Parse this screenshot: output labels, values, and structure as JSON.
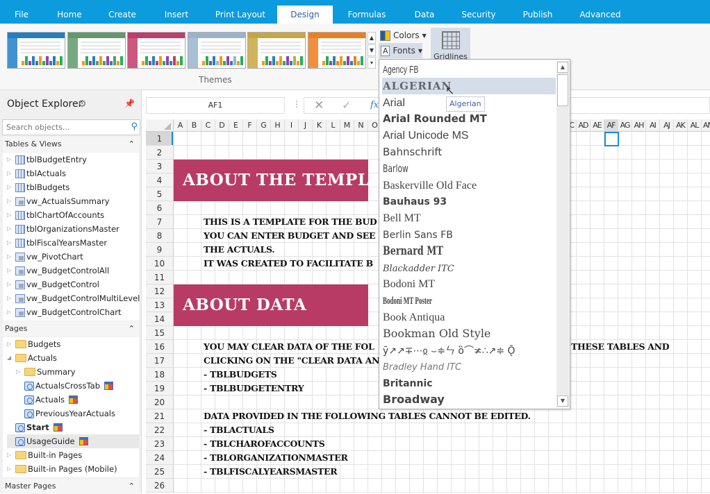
{
  "tabs": [
    {
      "label": "File"
    },
    {
      "label": "Home"
    },
    {
      "label": "Create"
    },
    {
      "label": "Insert"
    },
    {
      "label": "Print Layout"
    },
    {
      "label": "Design",
      "active": true
    },
    {
      "label": "Formulas"
    },
    {
      "label": "Data"
    },
    {
      "label": "Security"
    },
    {
      "label": "Publish"
    },
    {
      "label": "Advanced"
    }
  ],
  "ribbon": {
    "themes_label": "Themes",
    "themes": [
      {
        "color": "#1f7fc8"
      },
      {
        "color": "#5f9a6a"
      },
      {
        "color": "#c23b6b"
      },
      {
        "color": "#9ab4cf"
      },
      {
        "color": "#c8a640"
      },
      {
        "color": "#ef7d1a"
      }
    ],
    "colors_label": "Colors",
    "fonts_label": "Fonts",
    "gridlines_label": "Gridlines"
  },
  "explorer": {
    "title": "Object Explorer",
    "search_placeholder": "Search objects...",
    "tables_header": "Tables & Views",
    "tables": [
      {
        "label": "tblBudgetEntry",
        "type": "table"
      },
      {
        "label": "tblActuals",
        "type": "table"
      },
      {
        "label": "tblBudgets",
        "type": "table"
      },
      {
        "label": "vw_ActualsSummary",
        "type": "view"
      },
      {
        "label": "tblChartOfAccounts",
        "type": "table"
      },
      {
        "label": "tblOrganizationsMaster",
        "type": "table"
      },
      {
        "label": "tblFiscalYearsMaster",
        "type": "table"
      },
      {
        "label": "vw_PivotChart",
        "type": "view"
      },
      {
        "label": "vw_BudgetControlAll",
        "type": "view"
      },
      {
        "label": "vw_BudgetControl",
        "type": "view"
      },
      {
        "label": "vw_BudgetControlMultiLevel",
        "type": "view"
      },
      {
        "label": "vw_BudgetControlChart",
        "type": "view"
      }
    ],
    "pages_header": "Pages",
    "pages": [
      {
        "label": "Budgets",
        "type": "folder",
        "level": 0,
        "expand": "closed"
      },
      {
        "label": "Actuals",
        "type": "folder",
        "level": 0,
        "expand": "open"
      },
      {
        "label": "Summary",
        "type": "folder",
        "level": 1,
        "expand": "closed"
      },
      {
        "label": "ActualsCrossTab",
        "type": "page",
        "level": 1,
        "layout": true
      },
      {
        "label": "Actuals",
        "type": "page",
        "level": 1,
        "layout": true
      },
      {
        "label": "PreviousYearActuals",
        "type": "page",
        "level": 1
      },
      {
        "label": "Start",
        "type": "page",
        "level": 0,
        "layout": true,
        "bold": true
      },
      {
        "label": "UsageGuide",
        "type": "page",
        "level": 0,
        "layout": true,
        "selected": true
      },
      {
        "label": "Built-in Pages",
        "type": "folder",
        "level": 0,
        "expand": "closed"
      },
      {
        "label": "Built-in Pages (Mobile)",
        "type": "folder",
        "level": 0,
        "expand": "closed"
      }
    ],
    "master_header": "Master Pages"
  },
  "formula": {
    "namebox": "AF1",
    "value": ""
  },
  "sheet": {
    "columns": [
      "A",
      "B",
      "C",
      "D",
      "E",
      "F",
      "G",
      "H",
      "I",
      "J",
      "K",
      "L",
      "M",
      "N",
      "O",
      "P",
      "Q",
      "R",
      "S",
      "T",
      "U",
      "V",
      "W",
      "X",
      "Y",
      "Z",
      "AA",
      "AB",
      "AC",
      "AD",
      "AE",
      "AF",
      "AG",
      "AH",
      "AI",
      "AJ",
      "AK",
      "AL",
      "AM"
    ],
    "rows": [
      1,
      2,
      3,
      4,
      5,
      6,
      7,
      8,
      9,
      10,
      11,
      12,
      13,
      14,
      15,
      16,
      17,
      18,
      19,
      20,
      21,
      22,
      23,
      24,
      25,
      26
    ],
    "selected_cell": "AF1",
    "banner_color": "#b83b65",
    "banners": [
      {
        "row": 3,
        "text": "ABOUT THE TEMPLA"
      },
      {
        "row": 12,
        "text": "ABOUT DATA"
      }
    ],
    "lines": [
      {
        "row": 7,
        "text": "THIS IS A TEMPLATE FOR THE BUD"
      },
      {
        "row": 8,
        "text": "YOU CAN ENTER BUDGET AND SEE"
      },
      {
        "row": 9,
        "text": "THE ACTUALS."
      },
      {
        "row": 10,
        "text": "IT WAS CREATED TO FACILITATE B"
      },
      {
        "row": 16,
        "text": "YOU MAY CLEAR DATA OF THE FOL",
        "tail": "THESE TABLES AND"
      },
      {
        "row": 17,
        "text": "CLICKING ON THE \"CLEAR DATA AN"
      },
      {
        "row": 18,
        "text": "- TBLBUDGETS"
      },
      {
        "row": 19,
        "text": "- TBLBUDGETENTRY"
      },
      {
        "row": 21,
        "text": "DATA PROVIDED IN THE FOLLOWING TABLES CANNOT BE EDITED."
      },
      {
        "row": 22,
        "text": "- TBLACTUALS"
      },
      {
        "row": 23,
        "text": "- TBLCHAROFACCOUNTS"
      },
      {
        "row": 24,
        "text": "- TBLORGANIZATIONMASTER"
      },
      {
        "row": 25,
        "text": "- TBLFISCALYEARSMASTER"
      }
    ]
  },
  "fonts_dropdown": {
    "hovered": "Algerian",
    "tooltip": "Algerian",
    "items": [
      "Agency FB",
      "ALGERIAN",
      "Arial",
      "Arial Rounded MT",
      "Arial Unicode MS",
      "Bahnschrift",
      "Barlow",
      "Baskerville Old Face",
      "Bauhaus 93",
      "Bell MT",
      "Berlin Sans FB",
      "Bernard MT",
      "Blackadder ITC",
      "Bodoni MT",
      "Bodoni MT Poster",
      "Book Antiqua",
      "Bookman Old Style",
      "ȳ↗↗∓⋯ჲ ⌣≑ㄣ ὃ⌒≭∴↗≑ Ǭ",
      "Bradley Hand ITC",
      "Britannic",
      "Broadway"
    ]
  }
}
